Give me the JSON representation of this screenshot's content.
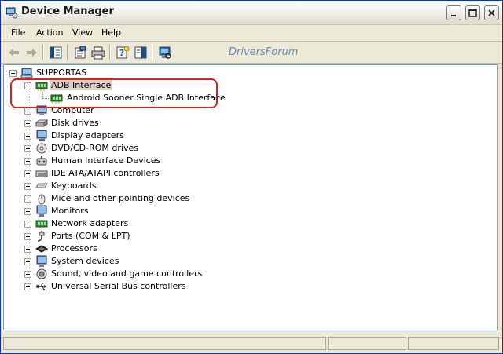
{
  "window": {
    "title": "Device Manager"
  },
  "menu": {
    "file": "File",
    "action": "Action",
    "view": "View",
    "help": "Help"
  },
  "toolbar": {
    "watermark": "DriversForum"
  },
  "tree": {
    "root": "SUPPORTAS",
    "adb": {
      "label": "ADB Interface",
      "child": "Android Sooner Single ADB Interface"
    },
    "categories": [
      {
        "label": "Computer",
        "icon": "computer-icon"
      },
      {
        "label": "Disk drives",
        "icon": "disk-drive-icon"
      },
      {
        "label": "Display adapters",
        "icon": "display-adapter-icon"
      },
      {
        "label": "DVD/CD-ROM drives",
        "icon": "cdrom-icon"
      },
      {
        "label": "Human Interface Devices",
        "icon": "hid-icon"
      },
      {
        "label": "IDE ATA/ATAPI controllers",
        "icon": "ide-controller-icon"
      },
      {
        "label": "Keyboards",
        "icon": "keyboard-icon"
      },
      {
        "label": "Mice and other pointing devices",
        "icon": "mouse-icon"
      },
      {
        "label": "Monitors",
        "icon": "monitor-icon"
      },
      {
        "label": "Network adapters",
        "icon": "network-adapter-icon"
      },
      {
        "label": "Ports (COM & LPT)",
        "icon": "port-icon"
      },
      {
        "label": "Processors",
        "icon": "processor-icon"
      },
      {
        "label": "System devices",
        "icon": "system-device-icon"
      },
      {
        "label": "Sound, video and game controllers",
        "icon": "sound-icon"
      },
      {
        "label": "Universal Serial Bus controllers",
        "icon": "usb-icon"
      }
    ]
  },
  "colors": {
    "highlight_border": "#e02020",
    "selection": "#d4d0c8"
  }
}
